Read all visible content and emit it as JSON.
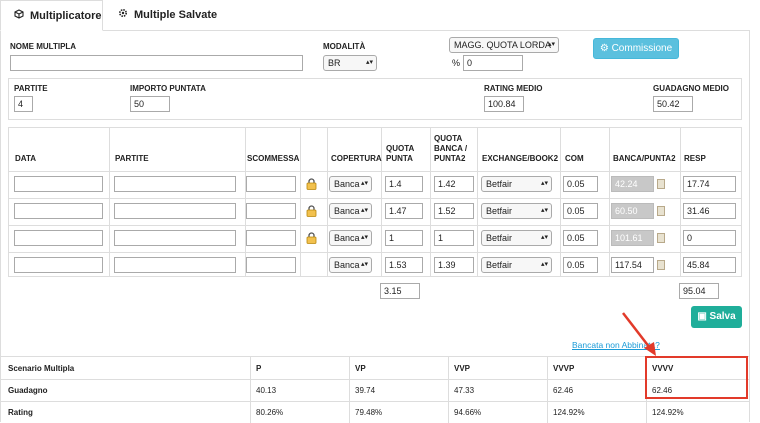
{
  "tabs": [
    {
      "label": "Multiplicatore"
    },
    {
      "label": "Multiple Salvate"
    }
  ],
  "form": {
    "nome_multipla_label": "NOME MULTIPLA",
    "nome_multipla_value": "",
    "modalita_label": "MODALITÀ",
    "modalita_value": "BR",
    "quota_type_value": "MAGG. QUOTA LORDA",
    "percent_symbol": "%",
    "percent_value": "0",
    "commissione_label": "Commissione",
    "partite_label": "PARTITE",
    "partite_value": "4",
    "importo_label": "IMPORTO PUNTATA",
    "importo_value": "50",
    "rating_label": "RATING MEDIO",
    "rating_value": "100.84",
    "guadagno_label": "GUADAGNO MEDIO",
    "guadagno_value": "50.42"
  },
  "table": {
    "headers": [
      "DATA",
      "PARTITE",
      "SCOMMESSA",
      "COPERTURA",
      "QUOTA PUNTA",
      "QUOTA BANCA / PUNTA2",
      "EXCHANGE/BOOK2",
      "COM",
      "BANCA/PUNTA2",
      "RESP"
    ],
    "rows": [
      {
        "data": "",
        "partite": "",
        "scommessa": "",
        "locked": true,
        "copertura": "Banca",
        "quota_punta": "1.4",
        "quota_banca": "1.42",
        "exchange": "Betfair",
        "com": "0.05",
        "banca": "42.24",
        "banca_shaded": true,
        "resp": "17.74"
      },
      {
        "data": "",
        "partite": "",
        "scommessa": "",
        "locked": true,
        "copertura": "Banca",
        "quota_punta": "1.47",
        "quota_banca": "1.52",
        "exchange": "Betfair",
        "com": "0.05",
        "banca": "60.50",
        "banca_shaded": true,
        "resp": "31.46"
      },
      {
        "data": "",
        "partite": "",
        "scommessa": "",
        "locked": true,
        "copertura": "Banca",
        "quota_punta": "1",
        "quota_banca": "1",
        "exchange": "Betfair",
        "com": "0.05",
        "banca": "101.61",
        "banca_shaded": true,
        "resp": "0"
      },
      {
        "data": "",
        "partite": "",
        "scommessa": "",
        "locked": false,
        "copertura": "Banca",
        "quota_punta": "1.53",
        "quota_banca": "1.39",
        "exchange": "Betfair",
        "com": "0.05",
        "banca": "117.54",
        "banca_shaded": false,
        "resp": "45.84"
      }
    ],
    "total_quota": "3.15",
    "total_resp": "95.04"
  },
  "salva_label": "Salva",
  "bancata_link": "Bancata non Abbinata?",
  "scenario": {
    "headers": [
      "Scenario Multipla",
      "P",
      "VP",
      "VVP",
      "VVVP",
      "VVVV"
    ],
    "rows": [
      {
        "label": "Guadagno",
        "values": [
          "40.13",
          "39.74",
          "47.33",
          "62.46",
          "62.46"
        ]
      },
      {
        "label": "Rating",
        "values": [
          "80.26%",
          "79.48%",
          "94.66%",
          "124.92%",
          "124.92%"
        ]
      }
    ]
  },
  "colors": {
    "info": "#5bc0de",
    "success": "#1fae9a",
    "highlight": "#e23a2a",
    "link": "#1a9bd7"
  }
}
